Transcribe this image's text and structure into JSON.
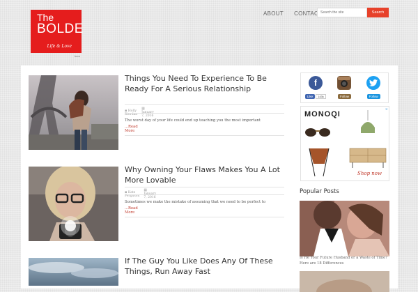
{
  "logo": {
    "line1": "The",
    "line2": "BOLDE",
    "line3": "Life & Love"
  },
  "tagline": "here",
  "nav": {
    "items": [
      {
        "label": "ABOUT"
      },
      {
        "label": "CONTACT"
      }
    ]
  },
  "search": {
    "placeholder": "Search the site",
    "button_label": "Search"
  },
  "posts": [
    {
      "title": "Things You Need To Experience To Be Ready For A Serious Relationship",
      "author": "Holly Riordan",
      "date": "January 7, 2016",
      "excerpt": "The worst day of your life could end up teaching you the most important",
      "more_label": "...Read More"
    },
    {
      "title": "Why Owning Your Flaws Makes You A Lot More Lovable",
      "author": "Kate Ferguson",
      "date": "January 7, 2016",
      "excerpt": "Sometimes we make the mistake of assuming that we need to be perfect to",
      "more_label": "...Read More"
    },
    {
      "title": "If The Guy You Like Does Any Of These Things, Run Away Fast"
    }
  ],
  "social": {
    "facebook": {
      "icon_letter": "f",
      "like_label": "Like",
      "count": "143k"
    },
    "instagram": {
      "follow_label": "Follow"
    },
    "twitter": {
      "follow_label": "Follow"
    }
  },
  "ad": {
    "brand": "MONOQI",
    "shop_label": "Shop now",
    "close": "×"
  },
  "popular": {
    "heading": "Popular Posts",
    "caption": "Is He Your Future Husband or a Waste of Time? Here are 18 Differences"
  },
  "colors": {
    "accent": "#e51d1d",
    "search_button": "#e7412a",
    "read_more": "#c0392b",
    "facebook": "#3b5998",
    "twitter": "#1da1f2"
  }
}
